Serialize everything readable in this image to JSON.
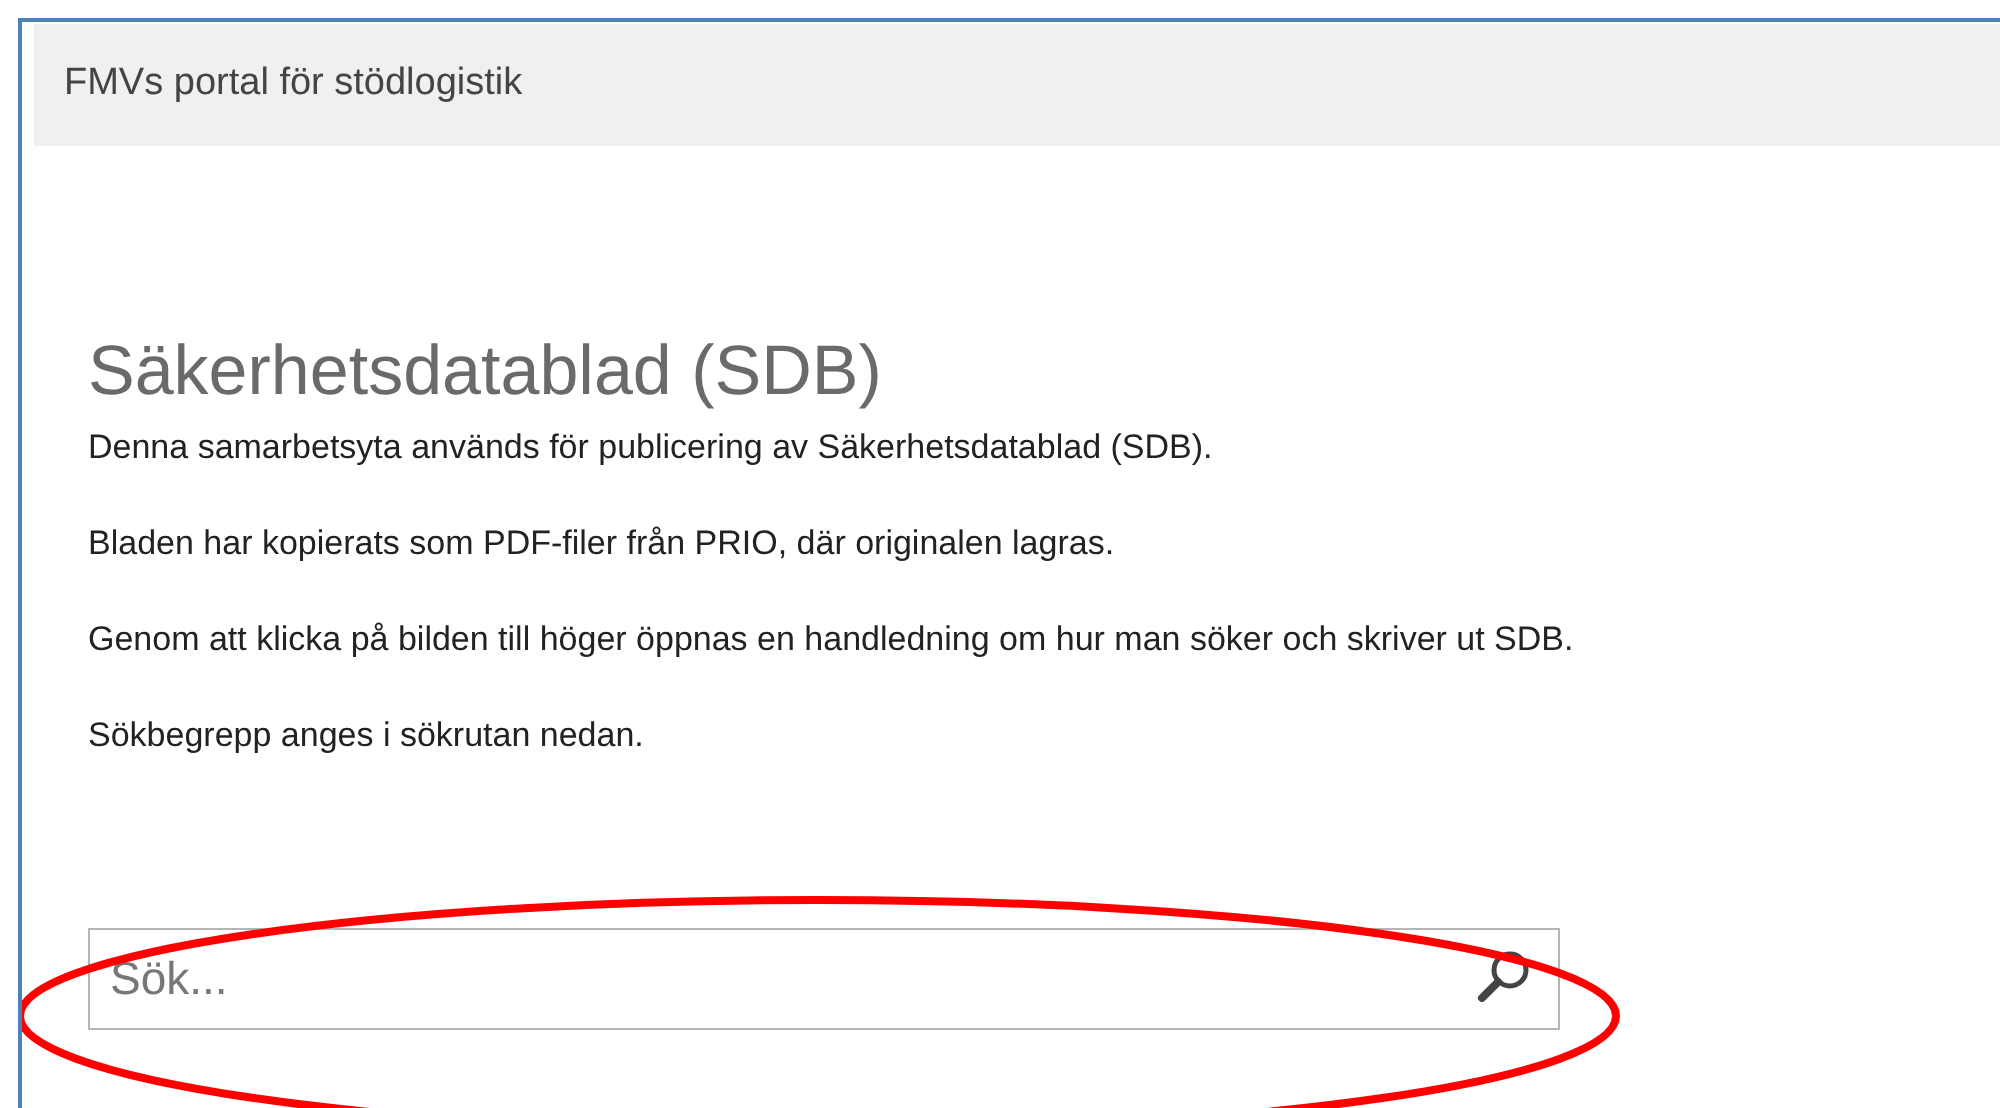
{
  "header": {
    "title": "FMVs portal för stödlogistik"
  },
  "page": {
    "heading": "Säkerhetsdatablad (SDB)",
    "paragraphs": [
      "Denna samarbetsyta används för publicering av Säkerhetsdatablad (SDB).",
      "Bladen har kopierats som PDF-filer från PRIO, där originalen lagras.",
      "Genom att klicka på bilden till höger öppnas en handledning om hur man söker och skriver ut SDB.",
      "Sökbegrepp anges i sökrutan nedan."
    ]
  },
  "search": {
    "placeholder": "Sök...",
    "highlighted": true
  }
}
